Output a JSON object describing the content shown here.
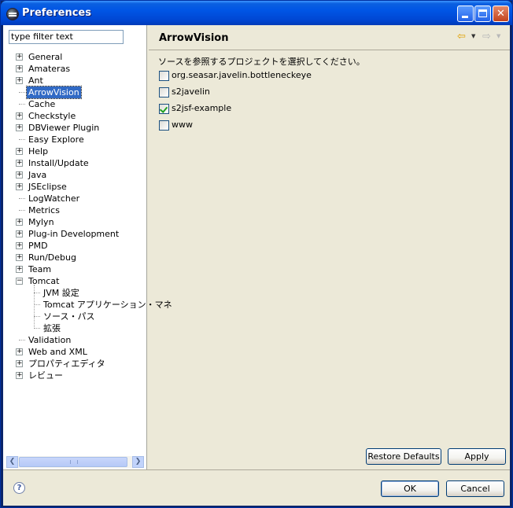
{
  "window": {
    "title": "Preferences"
  },
  "filter": {
    "value": "type filter text"
  },
  "tree": {
    "items": [
      {
        "label": "General",
        "expandable": true,
        "level": 0
      },
      {
        "label": "Amateras",
        "expandable": true,
        "level": 0
      },
      {
        "label": "Ant",
        "expandable": true,
        "level": 0
      },
      {
        "label": "ArrowVision",
        "expandable": false,
        "level": 0,
        "selected": true
      },
      {
        "label": "Cache",
        "expandable": false,
        "level": 0
      },
      {
        "label": "Checkstyle",
        "expandable": true,
        "level": 0
      },
      {
        "label": "DBViewer Plugin",
        "expandable": true,
        "level": 0
      },
      {
        "label": "Easy Explore",
        "expandable": false,
        "level": 0
      },
      {
        "label": "Help",
        "expandable": true,
        "level": 0
      },
      {
        "label": "Install/Update",
        "expandable": true,
        "level": 0
      },
      {
        "label": "Java",
        "expandable": true,
        "level": 0
      },
      {
        "label": "JSEclipse",
        "expandable": true,
        "level": 0
      },
      {
        "label": "LogWatcher",
        "expandable": false,
        "level": 0
      },
      {
        "label": "Metrics",
        "expandable": false,
        "level": 0
      },
      {
        "label": "Mylyn",
        "expandable": true,
        "level": 0
      },
      {
        "label": "Plug-in Development",
        "expandable": true,
        "level": 0
      },
      {
        "label": "PMD",
        "expandable": true,
        "level": 0
      },
      {
        "label": "Run/Debug",
        "expandable": true,
        "level": 0
      },
      {
        "label": "Team",
        "expandable": true,
        "level": 0
      },
      {
        "label": "Tomcat",
        "expandable": true,
        "expanded": true,
        "level": 0
      },
      {
        "label": "JVM 設定",
        "expandable": false,
        "level": 1
      },
      {
        "label": "Tomcat アプリケーション・マネ",
        "expandable": false,
        "level": 1
      },
      {
        "label": "ソース・パス",
        "expandable": false,
        "level": 1
      },
      {
        "label": "拡張",
        "expandable": false,
        "level": 1
      },
      {
        "label": "Validation",
        "expandable": false,
        "level": 0
      },
      {
        "label": "Web and XML",
        "expandable": true,
        "level": 0
      },
      {
        "label": "プロパティエディタ",
        "expandable": true,
        "level": 0
      },
      {
        "label": "レビュー",
        "expandable": true,
        "level": 0
      }
    ]
  },
  "page": {
    "title": "ArrowVision",
    "instruction": "ソースを参照するプロジェクトを選択してください。",
    "projects": [
      {
        "label": "org.seasar.javelin.bottleneckeye",
        "checked": false
      },
      {
        "label": "s2javelin",
        "checked": false
      },
      {
        "label": "s2jsf-example",
        "checked": true
      },
      {
        "label": "www",
        "checked": false
      }
    ],
    "restore_label": "Restore Defaults",
    "apply_label": "Apply"
  },
  "footer": {
    "ok_label": "OK",
    "cancel_label": "Cancel",
    "help_glyph": "?"
  },
  "icons": {
    "back": "back-arrow-icon",
    "forward": "forward-arrow-icon",
    "help": "help-icon"
  }
}
